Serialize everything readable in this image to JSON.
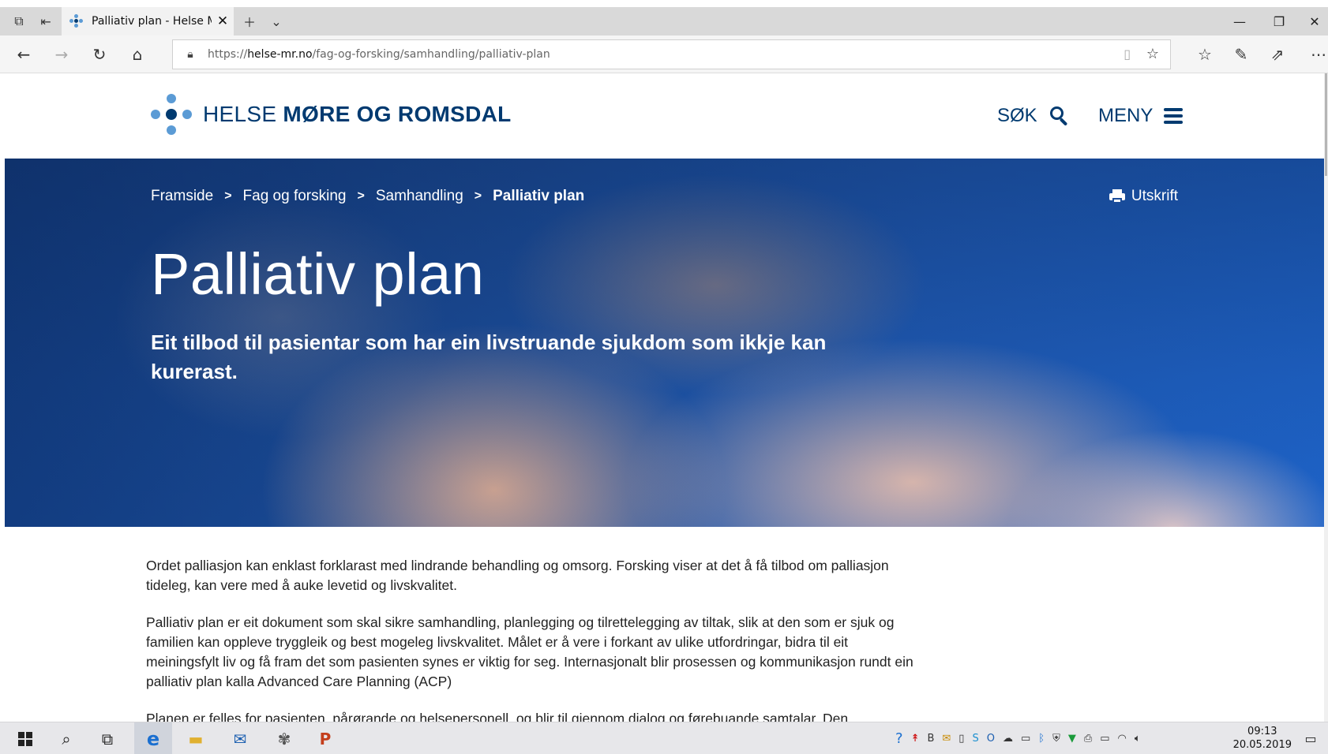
{
  "browser": {
    "tab_title": "Palliativ plan - Helse Mø",
    "url_protocol": "https://",
    "url_host": "helse-mr.no",
    "url_path": "/fag-og-forsking/samhandling/palliativ-plan"
  },
  "header": {
    "logo_light": "HELSE ",
    "logo_bold": "MØRE OG ROMSDAL",
    "search_label": "SØK",
    "menu_label": "MENY"
  },
  "breadcrumb": {
    "items": [
      "Framside",
      "Fag og forsking",
      "Samhandling"
    ],
    "current": "Palliativ plan"
  },
  "print_label": "Utskrift",
  "hero": {
    "title": "Palliativ plan",
    "lead": "Eit tilbod til pasientar som har ein livstruande sjukdom som ikkje kan kurerast."
  },
  "content": {
    "paragraphs": [
      "Ordet palliasjon kan enklast forklarast med lindrande behandling og omsorg. Forsking viser at det å få tilbod om palliasjon tideleg, kan vere med å auke levetid og livskvalitet.",
      "Palliativ plan er eit dokument som skal sikre samhandling, planlegging og tilrettelegging av tiltak, slik at den som er sjuk og familien kan oppleve tryggleik og best mogeleg livskvalitet. Målet er å vere i forkant av ulike utfordringar, bidra til eit meiningsfylt liv og få fram det som pasienten synes er viktig for seg. Internasjonalt blir prosessen og kommunikasjon rundt ein palliativ plan kalla Advanced Care Planning (ACP)",
      "Planen er felles for pasienten, pårørande og helsepersonell, og blir til gjennom dialog og førebuande samtalar. Den"
    ]
  },
  "taskbar": {
    "time": "09:13",
    "date": "20.05.2019"
  },
  "colors": {
    "brand_navy": "#003a70",
    "logo_dot_light": "#5b9bd5",
    "logo_dot_dark": "#003a70"
  }
}
